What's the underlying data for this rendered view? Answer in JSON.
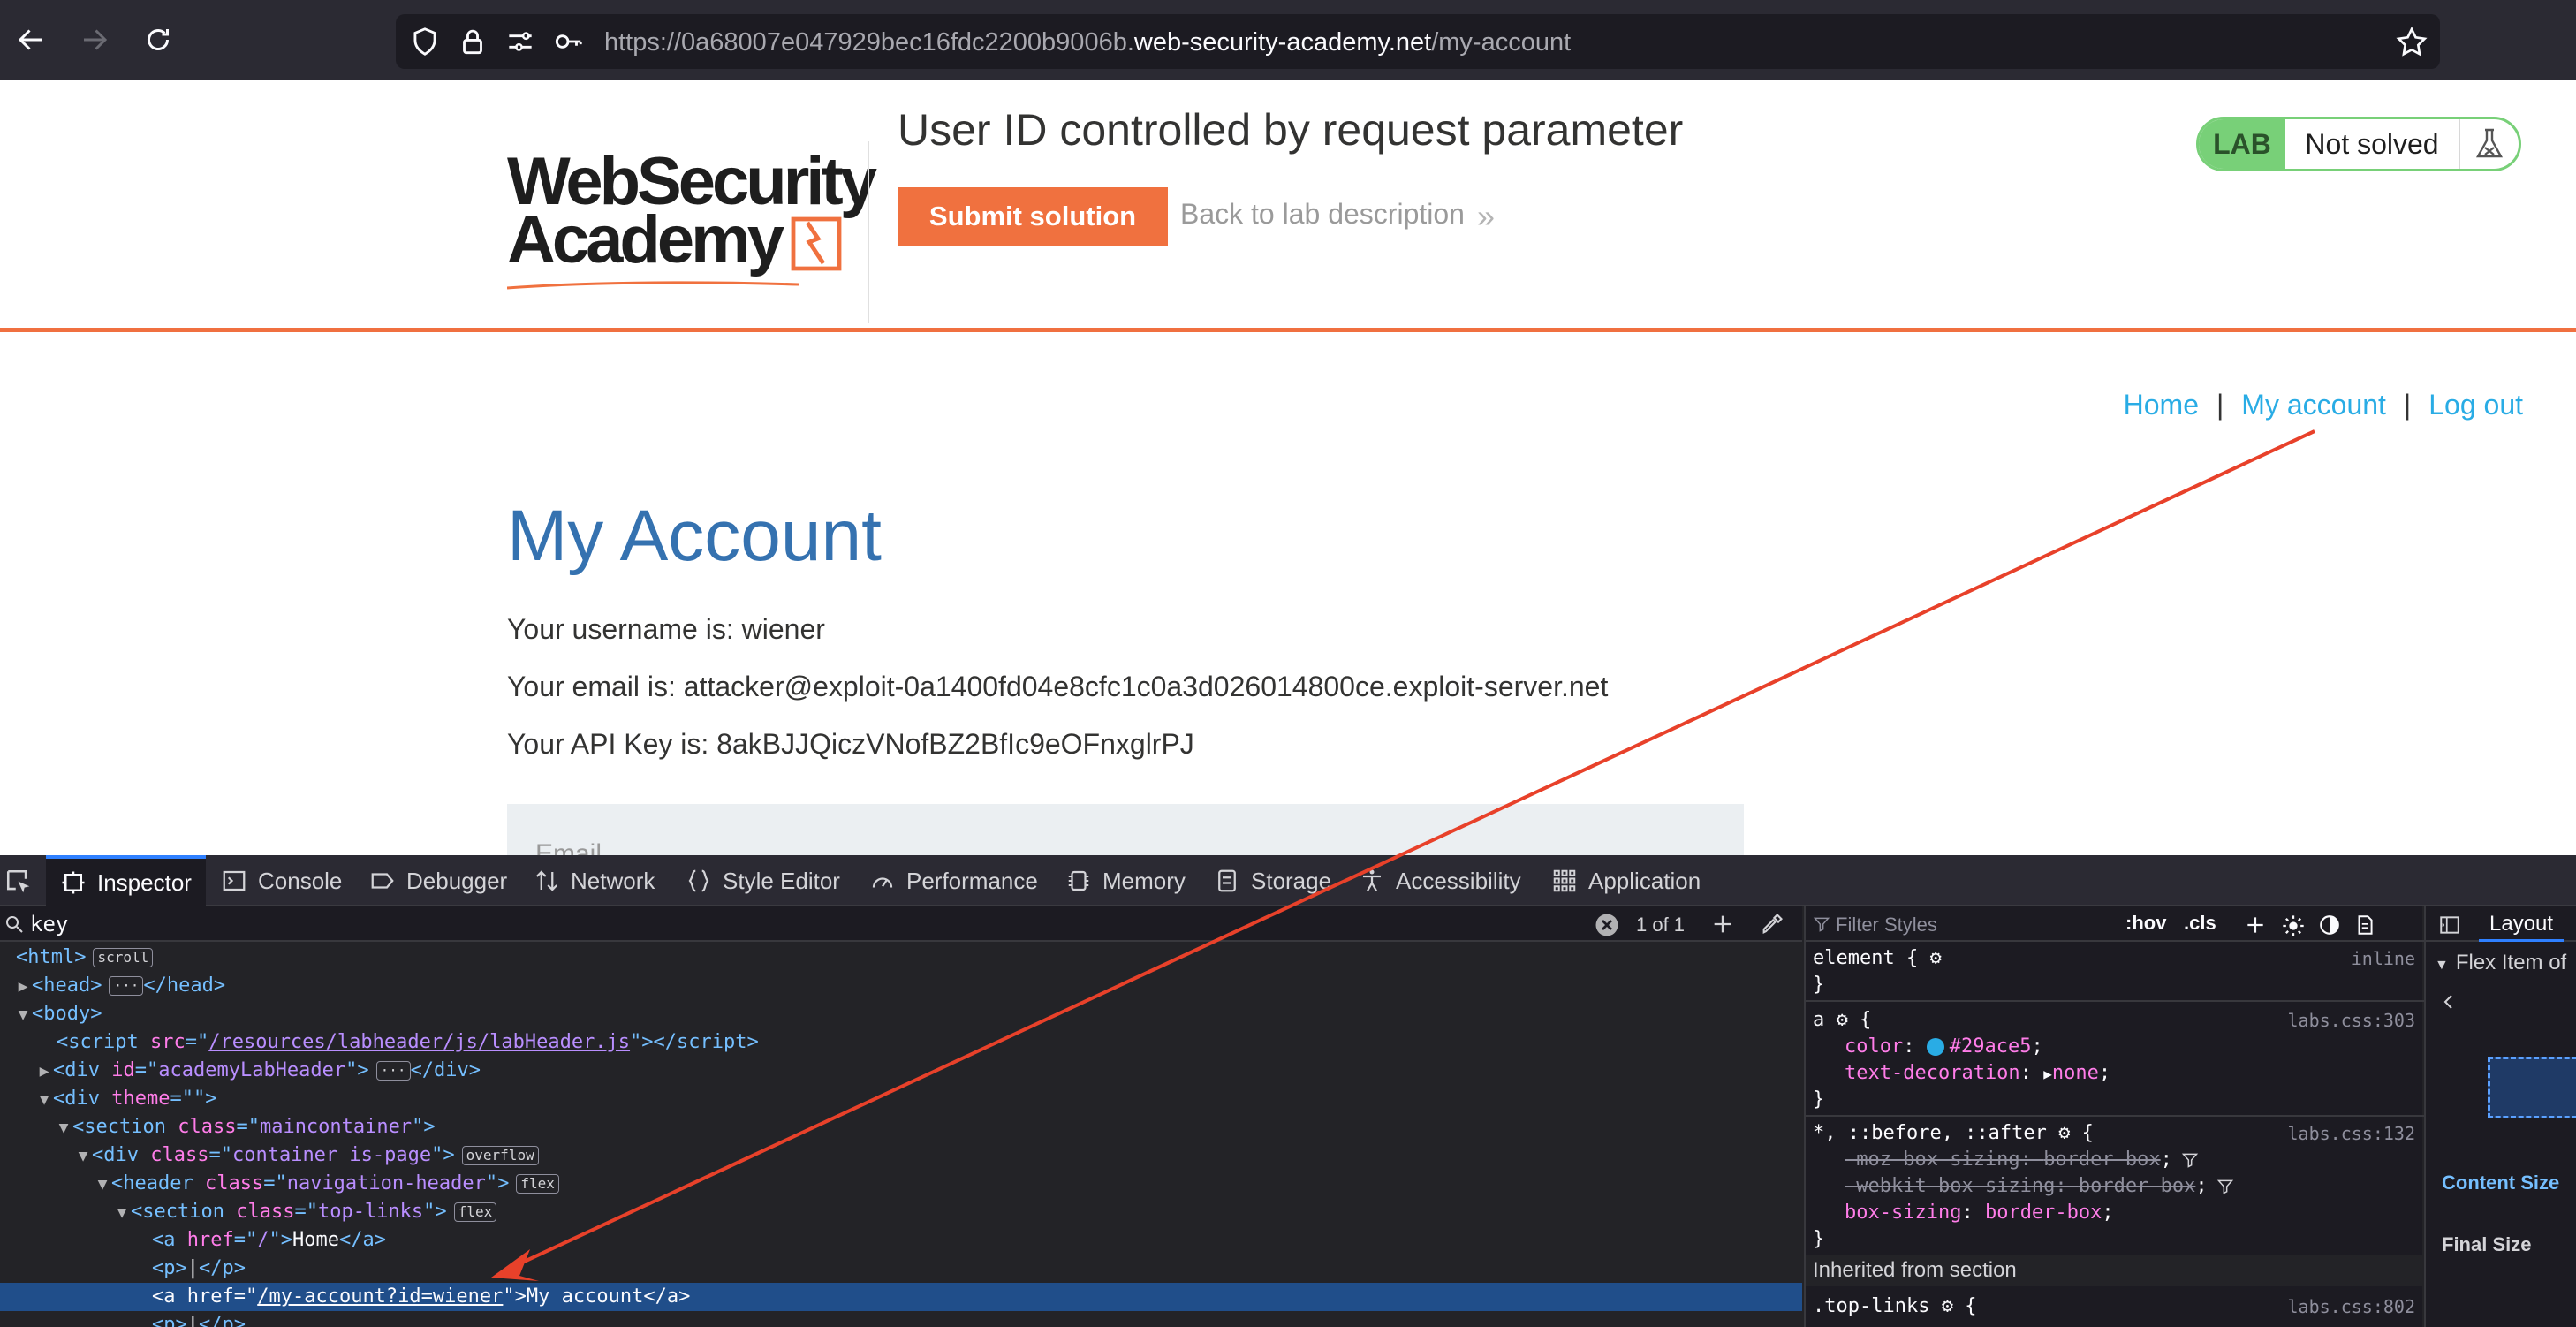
{
  "browser": {
    "url_prefix": "https://0a68007e047929bec16fdc2200b9006b.",
    "url_domain": "web-security-academy.net",
    "url_path": "/my-account"
  },
  "lab_header": {
    "logo_line1": "WebSecurity",
    "logo_line2": "Academy",
    "title": "User ID controlled by request parameter",
    "submit_label": "Submit solution",
    "back_label": "Back to lab description",
    "lab_tag": "LAB",
    "status": "Not solved"
  },
  "nav": {
    "home": "Home",
    "my_account": "My account",
    "logout": "Log out",
    "separator": "|"
  },
  "page": {
    "title": "My Account",
    "username_line": "Your username is: wiener",
    "email_line": "Your email is: attacker@exploit-0a1400fd04e8cfc1c0a3d026014800ce.exploit-server.net",
    "apikey_line": "Your API Key is: 8akBJJQiczVNofBZ2BfIc9eOFnxglrPJ",
    "email_field_label": "Email"
  },
  "devtools": {
    "tabs": [
      "Inspector",
      "Console",
      "Debugger",
      "Network",
      "Style Editor",
      "Performance",
      "Memory",
      "Storage",
      "Accessibility",
      "Application"
    ],
    "search_value": "key",
    "search_count": "1 of 1",
    "dom": {
      "html_badge": "scroll",
      "l_html": "html",
      "l_head": "head",
      "l_body": "body",
      "l_script_src": "/resources/labheader/js/labHeader.js",
      "l_div_id": "academyLabHeader",
      "l_div_theme": "",
      "l_section_class": "maincontainer",
      "l_container_class": "container is-page",
      "container_badge": "overflow",
      "l_header_class": "navigation-header",
      "flex_badge": "flex",
      "l_toplinks_class": "top-links",
      "l_home_href": "/",
      "l_home_text": "Home",
      "l_p_text": "|",
      "l_acct_href": "/my-account?id=wiener",
      "l_acct_text": "My account"
    },
    "rules": {
      "filter_placeholder": "Filter Styles",
      "hov": ":hov",
      "cls": ".cls",
      "element_selector": "element",
      "element_src": "inline",
      "a_selector": "a",
      "a_src": "labs.css:303",
      "color_prop": "color",
      "color_val": "#29ace5",
      "textdec_prop": "text-decoration",
      "textdec_val": "none",
      "star_selector": "*, ::before, ::after",
      "star_src": "labs.css:132",
      "moz_prop": "-moz-box-sizing",
      "webkit_prop": "-webkit-box-sizing",
      "boxsizing_prop": "box-sizing",
      "boxsizing_val": "border-box",
      "inherited": "Inherited from section",
      "toplinks_selector": ".top-links",
      "toplinks_src": "labs.css:802"
    },
    "layout": {
      "tab": "Layout",
      "flex_item": "Flex Item of",
      "content_size": "Content Size",
      "final_size": "Final Size"
    }
  },
  "colors": {
    "brand_orange": "#f0713f",
    "link_blue": "#29ace5",
    "title_blue": "#3572b0",
    "lab_green": "#78d078",
    "annotation_red": "#e8412a"
  }
}
